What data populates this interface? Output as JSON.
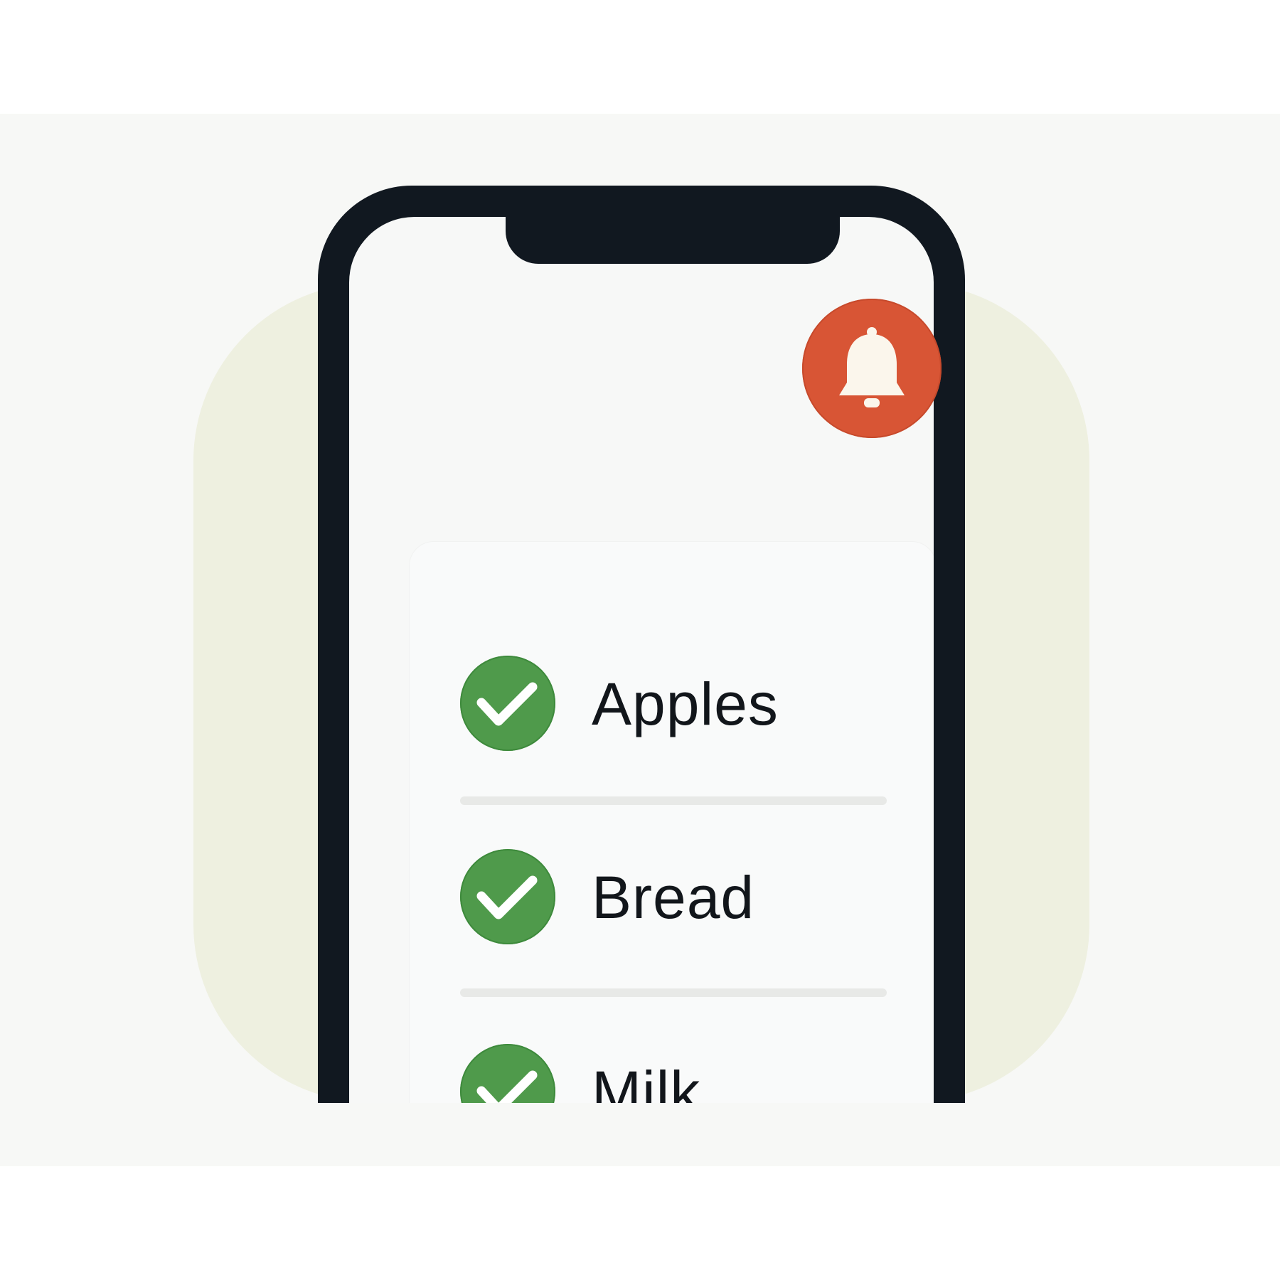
{
  "app": {
    "list_items": [
      {
        "label": "Apples",
        "checked": true,
        "icon": "check-circle-icon"
      },
      {
        "label": "Bread",
        "checked": true,
        "icon": "check-circle-icon"
      },
      {
        "label": "Milk",
        "checked": true,
        "icon": "check-circle-icon"
      }
    ],
    "notification": {
      "icon": "bell-icon"
    }
  },
  "colors": {
    "check_green": "#4f9a4b",
    "bell_red": "#d85535",
    "phone_bezel": "#111820",
    "backdrop_blob": "#eef0e0",
    "text": "#12161b"
  }
}
